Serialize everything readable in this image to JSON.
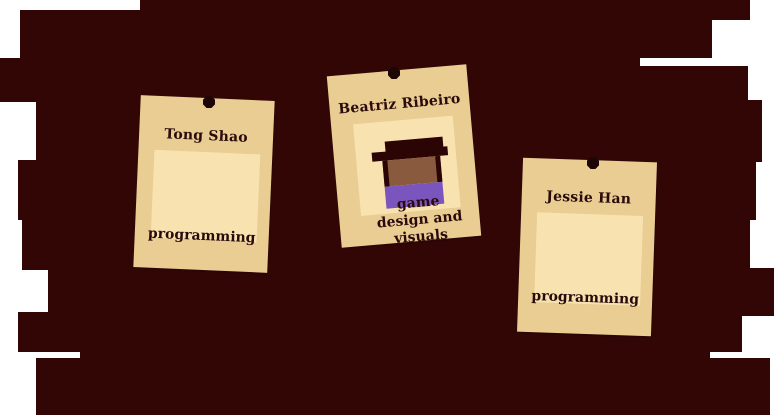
{
  "colors": {
    "board": "#330606",
    "card": "#e9cd92",
    "card_inner": "#f7e2b0",
    "pin": "#1e0606",
    "text": "#2a0a0a"
  },
  "cards": [
    {
      "name": "Tong Shao",
      "role": "programming",
      "portrait": null
    },
    {
      "name": "Beatriz Ribeiro",
      "role": "game design and visuals",
      "portrait": "pixel-character-icon"
    },
    {
      "name": "Jessie Han",
      "role": "programming",
      "portrait": null
    }
  ]
}
